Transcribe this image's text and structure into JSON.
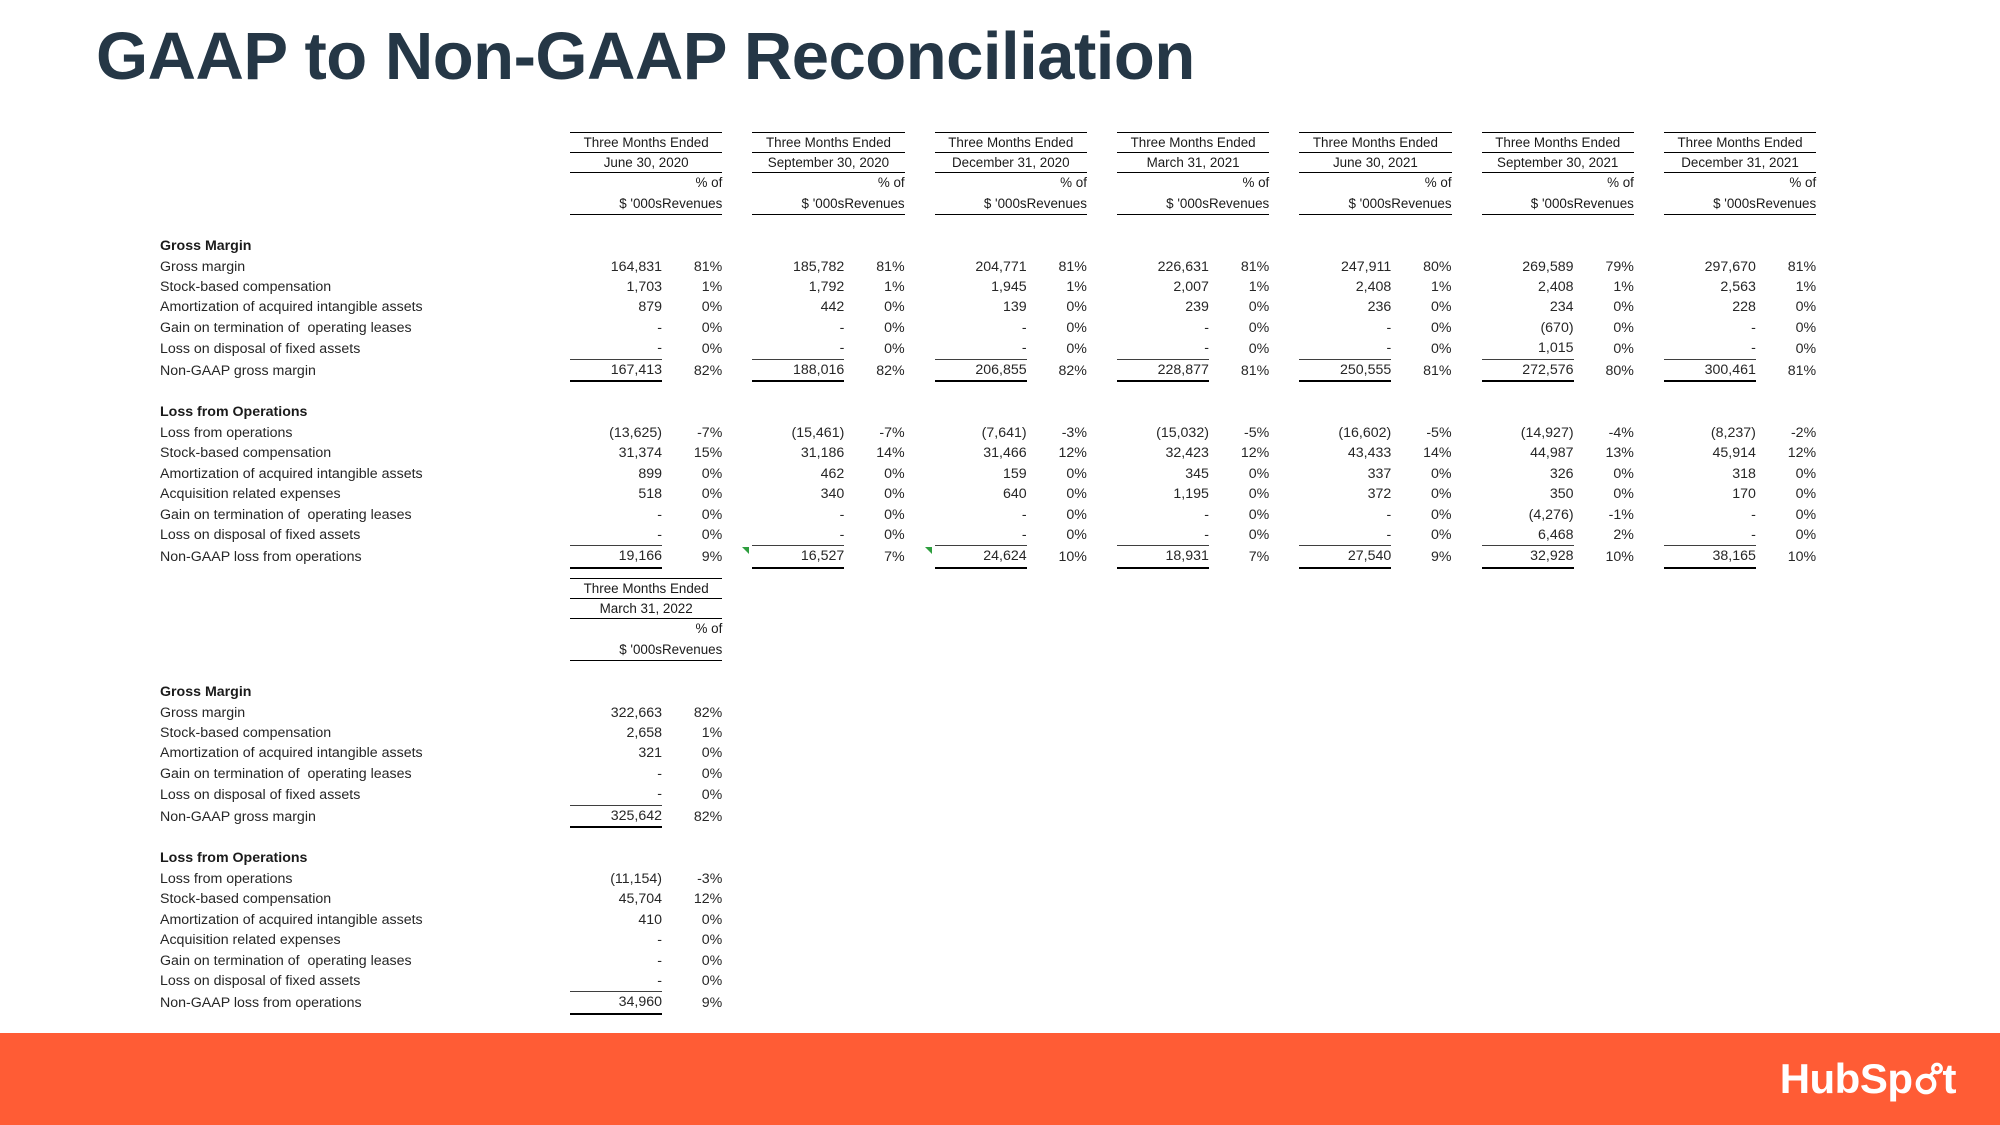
{
  "slide": {
    "title": "GAAP to Non-GAAP Reconciliation",
    "title_color": "#253746",
    "footer_color": "#ff5c35",
    "logo_text": "HubSp t"
  },
  "header_labels": {
    "period": "Three Months Ended",
    "pct_of": "% of",
    "revenues": "Revenues",
    "dollars": "$ '000s"
  },
  "sections": {
    "gross_margin": "Gross Margin",
    "loss_from_operations": "Loss from Operations"
  },
  "row_labels": {
    "gross_margin": "Gross margin",
    "stock_based_compensation": "Stock-based compensation",
    "amortization": "Amortization of acquired intangible assets",
    "acquisition_expenses": "Acquisition related expenses",
    "gain_termination": "Gain on termination of  operating leases",
    "loss_disposal": "Loss on disposal of fixed assets",
    "non_gaap_gross_margin": "Non-GAAP gross margin",
    "loss_from_operations": "Loss from operations",
    "non_gaap_loss_from_operations": "Non-GAAP loss from operations"
  },
  "chart_data": {
    "type": "table",
    "title": "GAAP to Non-GAAP Reconciliation",
    "tables": [
      {
        "id": "table-main",
        "periods": [
          "June 30, 2020",
          "September 30, 2020",
          "December 31, 2020",
          "March 31, 2021",
          "June 30, 2021",
          "September 30, 2021",
          "December 31, 2021"
        ],
        "sections": [
          {
            "name": "Gross Margin",
            "rows": [
              {
                "label": "Gross margin",
                "dollars": [
                  "164,831",
                  "185,782",
                  "204,771",
                  "226,631",
                  "247,911",
                  "269,589",
                  "297,670"
                ],
                "pct": [
                  "81%",
                  "81%",
                  "81%",
                  "81%",
                  "80%",
                  "79%",
                  "81%"
                ]
              },
              {
                "label": "Stock-based compensation",
                "dollars": [
                  "1,703",
                  "1,792",
                  "1,945",
                  "2,007",
                  "2,408",
                  "2,408",
                  "2,563"
                ],
                "pct": [
                  "1%",
                  "1%",
                  "1%",
                  "1%",
                  "1%",
                  "1%",
                  "1%"
                ]
              },
              {
                "label": "Amortization of acquired intangible assets",
                "dollars": [
                  "879",
                  "442",
                  "139",
                  "239",
                  "236",
                  "234",
                  "228"
                ],
                "pct": [
                  "0%",
                  "0%",
                  "0%",
                  "0%",
                  "0%",
                  "0%",
                  "0%"
                ]
              },
              {
                "label": "Gain on termination of  operating leases",
                "dollars": [
                  "-",
                  "-",
                  "-",
                  "-",
                  "-",
                  "(670)",
                  "-"
                ],
                "pct": [
                  "0%",
                  "0%",
                  "0%",
                  "0%",
                  "0%",
                  "0%",
                  "0%"
                ]
              },
              {
                "label": "Loss on disposal of fixed assets",
                "dollars": [
                  "-",
                  "-",
                  "-",
                  "-",
                  "-",
                  "1,015",
                  "-"
                ],
                "pct": [
                  "0%",
                  "0%",
                  "0%",
                  "0%",
                  "0%",
                  "0%",
                  "0%"
                ]
              },
              {
                "label": "Non-GAAP gross margin",
                "total": true,
                "dollars": [
                  "167,413",
                  "188,016",
                  "206,855",
                  "228,877",
                  "250,555",
                  "272,576",
                  "300,461"
                ],
                "pct": [
                  "82%",
                  "82%",
                  "82%",
                  "81%",
                  "81%",
                  "80%",
                  "81%"
                ]
              }
            ]
          },
          {
            "name": "Loss from Operations",
            "rows": [
              {
                "label": "Loss from operations",
                "dollars": [
                  "(13,625)",
                  "(15,461)",
                  "(7,641)",
                  "(15,032)",
                  "(16,602)",
                  "(14,927)",
                  "(8,237)"
                ],
                "pct": [
                  "-7%",
                  "-7%",
                  "-3%",
                  "-5%",
                  "-5%",
                  "-4%",
                  "-2%"
                ]
              },
              {
                "label": "Stock-based compensation",
                "dollars": [
                  "31,374",
                  "31,186",
                  "31,466",
                  "32,423",
                  "43,433",
                  "44,987",
                  "45,914"
                ],
                "pct": [
                  "15%",
                  "14%",
                  "12%",
                  "12%",
                  "14%",
                  "13%",
                  "12%"
                ]
              },
              {
                "label": "Amortization of acquired intangible assets",
                "dollars": [
                  "899",
                  "462",
                  "159",
                  "345",
                  "337",
                  "326",
                  "318"
                ],
                "pct": [
                  "0%",
                  "0%",
                  "0%",
                  "0%",
                  "0%",
                  "0%",
                  "0%"
                ]
              },
              {
                "label": "Acquisition related expenses",
                "dollars": [
                  "518",
                  "340",
                  "640",
                  "1,195",
                  "372",
                  "350",
                  "170"
                ],
                "pct": [
                  "0%",
                  "0%",
                  "0%",
                  "0%",
                  "0%",
                  "0%",
                  "0%"
                ]
              },
              {
                "label": "Gain on termination of  operating leases",
                "dollars": [
                  "-",
                  "-",
                  "-",
                  "-",
                  "-",
                  "(4,276)",
                  "-"
                ],
                "pct": [
                  "0%",
                  "0%",
                  "0%",
                  "0%",
                  "0%",
                  "-1%",
                  "0%"
                ]
              },
              {
                "label": "Loss on disposal of fixed assets",
                "dollars": [
                  "-",
                  "-",
                  "-",
                  "-",
                  "-",
                  "6,468",
                  "-"
                ],
                "pct": [
                  "0%",
                  "0%",
                  "0%",
                  "0%",
                  "0%",
                  "2%",
                  "0%"
                ]
              },
              {
                "label": "Non-GAAP loss from operations",
                "total": true,
                "comment_markers": [
                  1,
                  2
                ],
                "dollars": [
                  "19,166",
                  "16,527",
                  "24,624",
                  "18,931",
                  "27,540",
                  "32,928",
                  "38,165"
                ],
                "pct": [
                  "9%",
                  "7%",
                  "10%",
                  "7%",
                  "9%",
                  "10%",
                  "10%"
                ]
              }
            ]
          }
        ]
      },
      {
        "id": "table-q1",
        "periods": [
          "March 31, 2022"
        ],
        "sections": [
          {
            "name": "Gross Margin",
            "rows": [
              {
                "label": "Gross margin",
                "dollars": [
                  "322,663"
                ],
                "pct": [
                  "82%"
                ]
              },
              {
                "label": "Stock-based compensation",
                "dollars": [
                  "2,658"
                ],
                "pct": [
                  "1%"
                ]
              },
              {
                "label": "Amortization of acquired intangible assets",
                "dollars": [
                  "321"
                ],
                "pct": [
                  "0%"
                ]
              },
              {
                "label": "Gain on termination of  operating leases",
                "dollars": [
                  "-"
                ],
                "pct": [
                  "0%"
                ]
              },
              {
                "label": "Loss on disposal of fixed assets",
                "dollars": [
                  "-"
                ],
                "pct": [
                  "0%"
                ]
              },
              {
                "label": "Non-GAAP gross margin",
                "total": true,
                "dollars": [
                  "325,642"
                ],
                "pct": [
                  "82%"
                ]
              }
            ]
          },
          {
            "name": "Loss from Operations",
            "rows": [
              {
                "label": "Loss from operations",
                "dollars": [
                  "(11,154)"
                ],
                "pct": [
                  "-3%"
                ]
              },
              {
                "label": "Stock-based compensation",
                "dollars": [
                  "45,704"
                ],
                "pct": [
                  "12%"
                ]
              },
              {
                "label": "Amortization of acquired intangible assets",
                "dollars": [
                  "410"
                ],
                "pct": [
                  "0%"
                ]
              },
              {
                "label": "Acquisition related expenses",
                "dollars": [
                  "-"
                ],
                "pct": [
                  "0%"
                ]
              },
              {
                "label": "Gain on termination of  operating leases",
                "dollars": [
                  "-"
                ],
                "pct": [
                  "0%"
                ]
              },
              {
                "label": "Loss on disposal of fixed assets",
                "dollars": [
                  "-"
                ],
                "pct": [
                  "0%"
                ]
              },
              {
                "label": "Non-GAAP loss from operations",
                "total": true,
                "dollars": [
                  "34,960"
                ],
                "pct": [
                  "9%"
                ]
              }
            ]
          }
        ]
      }
    ]
  }
}
